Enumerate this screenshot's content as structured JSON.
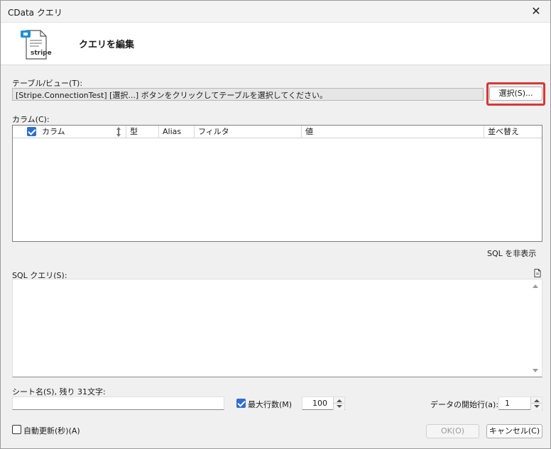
{
  "window": {
    "title": "CData クエリ",
    "close_glyph": "✕"
  },
  "header": {
    "heading": "クエリを編集",
    "logo_text": "stripe"
  },
  "table_section": {
    "label": "テーブル/ビュー(T):",
    "value": "[Stripe.ConnectionTest] [選択...] ボタンをクリックしてテーブルを選択してください。",
    "select_button": "選択(S)..."
  },
  "columns_section": {
    "label": "カラム(C):",
    "headers": {
      "column": "カラム",
      "type": "型",
      "alias": "Alias",
      "filter": "フィルタ",
      "value": "値",
      "sort": "並べ替え"
    }
  },
  "hide_sql_link": "SQL を非表示",
  "sql_section": {
    "label": "SQL クエリ(S):",
    "value": ""
  },
  "sheet_section": {
    "label": "シート名(S), 残り 31文字:",
    "value": ""
  },
  "max_rows": {
    "label": "最大行数(M)",
    "checked": true,
    "value": "100"
  },
  "start_row": {
    "label": "データの開始行(a):",
    "value": "1"
  },
  "auto_refresh": {
    "label": "自動更新(秒)(A)",
    "checked": false
  },
  "buttons": {
    "ok": "OK(O)",
    "cancel": "キャンセル(C)"
  },
  "colors": {
    "accent": "#2f6fcf",
    "highlight": "#d93636",
    "stripe_blue": "#1f8fd6"
  }
}
